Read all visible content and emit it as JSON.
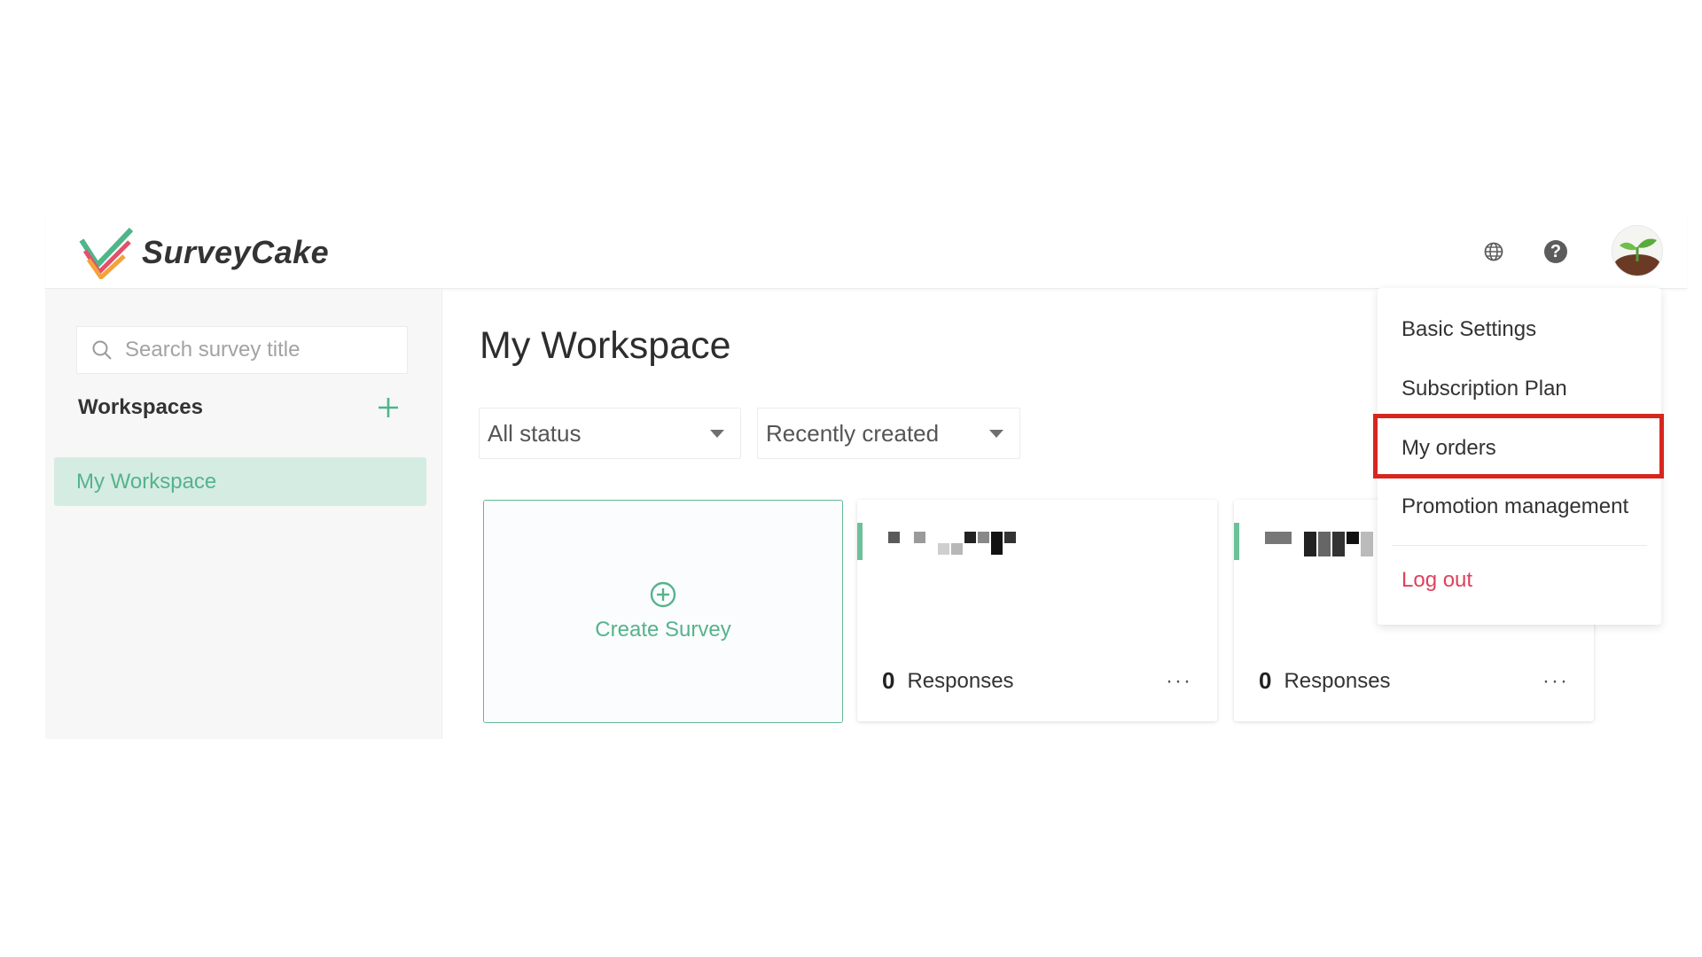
{
  "header": {
    "brand": "SurveyCake",
    "icons": [
      "globe-icon",
      "help-icon",
      "avatar-icon"
    ]
  },
  "sidebar": {
    "search_placeholder": "Search survey title",
    "workspaces_title": "Workspaces",
    "items": [
      {
        "label": "My Workspace",
        "active": true
      }
    ]
  },
  "main": {
    "title": "My Workspace",
    "filter_status": "All status",
    "filter_sort": "Recently created",
    "create_label": "Create Survey",
    "cards": [
      {
        "responses": "0",
        "responses_label": "Responses",
        "more": "···"
      },
      {
        "responses": "0",
        "responses_label": "Responses",
        "more": "···"
      }
    ]
  },
  "menu": {
    "items": [
      "Basic Settings",
      "Subscription Plan",
      "My orders",
      "Promotion management"
    ],
    "logout": "Log out",
    "highlighted": "My orders"
  },
  "colors": {
    "brand_green": "#55b38c",
    "active_bg": "#d5ece3",
    "logout_red": "#e0405c",
    "highlight_border": "#d6261f"
  }
}
